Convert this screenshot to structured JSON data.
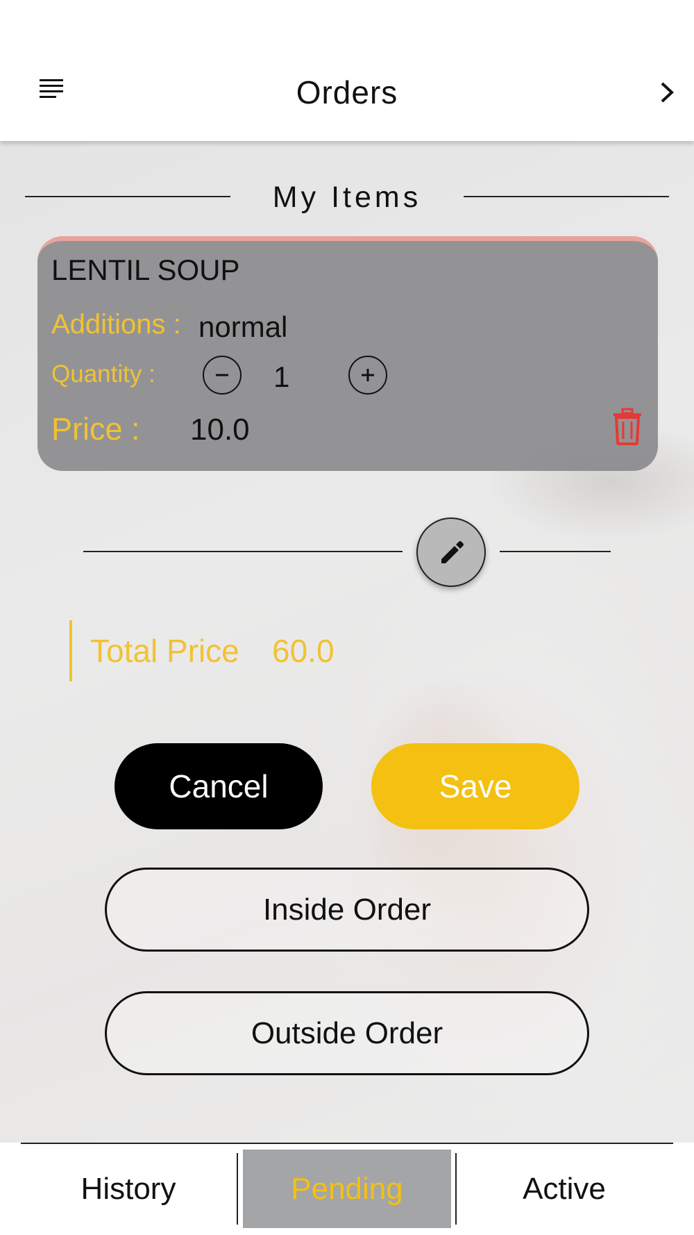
{
  "app_bar": {
    "title": "Orders",
    "menu_icon": "menu-icon",
    "next_icon": "chevron-right-icon"
  },
  "section": {
    "title": "My Items"
  },
  "item": {
    "name": "LENTIL SOUP",
    "additions_label": "Additions :",
    "additions_value": "normal",
    "quantity_label": "Quantity :",
    "quantity_value": "1",
    "price_label": "Price :",
    "price_value": "10.0"
  },
  "total": {
    "label": "Total Price",
    "value": "60.0"
  },
  "actions": {
    "cancel_label": "Cancel",
    "save_label": "Save",
    "inside_label": "Inside Order",
    "outside_label": "Outside Order"
  },
  "bottom_nav": {
    "tabs": [
      {
        "label": "History",
        "active": false
      },
      {
        "label": "Pending",
        "active": true
      },
      {
        "label": "Active",
        "active": false
      }
    ]
  },
  "colors": {
    "accent": "#f4c012",
    "danger": "#e53935",
    "card": "#808084"
  }
}
